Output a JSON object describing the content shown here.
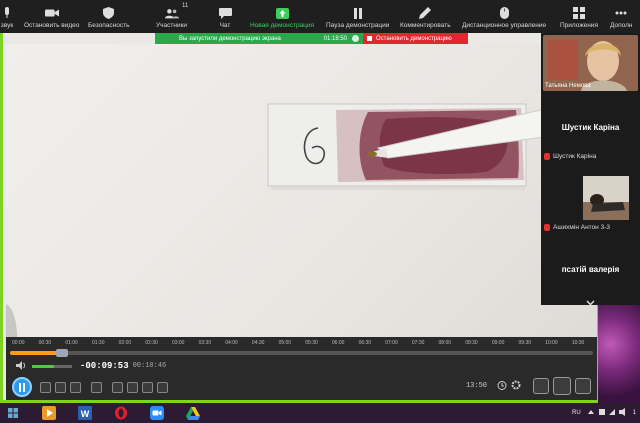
{
  "toolbar": {
    "items": [
      {
        "label": "звук",
        "icon": "microphone-icon"
      },
      {
        "label": "Остановить видео",
        "icon": "camera-icon"
      },
      {
        "label": "Безопасность",
        "icon": "shield-icon"
      },
      {
        "label": "Участники",
        "icon": "participants-icon",
        "count": "11"
      },
      {
        "label": "Чат",
        "icon": "chat-icon"
      },
      {
        "label": "Новая демонстрация",
        "icon": "share-screen-icon"
      },
      {
        "label": "Пауза демонстрации",
        "icon": "pause-icon"
      },
      {
        "label": "Комментировать",
        "icon": "pencil-icon"
      },
      {
        "label": "Дистанционное управление",
        "icon": "mouse-icon"
      },
      {
        "label": "Приложения",
        "icon": "apps-icon"
      },
      {
        "label": "Дополн",
        "icon": "more-icon"
      }
    ]
  },
  "share_banner": {
    "message": "Вы запустили демонстрацию экрана",
    "time": "01:18:50",
    "stop_label": "Остановить демонстрацию"
  },
  "slide": {
    "number_label": "6"
  },
  "player": {
    "timeline_labels": [
      "00:00",
      "00:30",
      "01:00",
      "01:30",
      "02:00",
      "02:30",
      "03:00",
      "03:30",
      "04:00",
      "04:30",
      "05:00",
      "05:30",
      "06:00",
      "06:30",
      "07:00",
      "07:30",
      "08:00",
      "08:30",
      "09:00",
      "09:30",
      "10:00",
      "10:30"
    ],
    "progress_fraction": 0.09,
    "volume_fraction": 0.55,
    "time_remaining": "-00:09:53",
    "time_total": "00:10:46",
    "clock": "13:50"
  },
  "participants": [
    {
      "name": "Татьяна Немова",
      "type": "video"
    },
    {
      "name": "Шустик Каріна",
      "type": "name-only"
    },
    {
      "name": "Шустик Каріна",
      "type": "label",
      "muted": true
    },
    {
      "name": "Ашихмін Антон 3-3",
      "type": "thumb",
      "muted": true
    },
    {
      "name": "псатій валерія",
      "type": "name-only"
    }
  ],
  "taskbar": {
    "apps": [
      "media-player-icon",
      "word-icon",
      "opera-icon",
      "zoom-icon",
      "drive-icon"
    ],
    "language": "RU",
    "clock_fragment": "1"
  },
  "colors": {
    "accent_green": "#7ed321",
    "share_green": "#2ba84a",
    "stop_red": "#e0282e",
    "progress_orange": "#ff9a1f",
    "play_blue": "#2f9be8"
  }
}
